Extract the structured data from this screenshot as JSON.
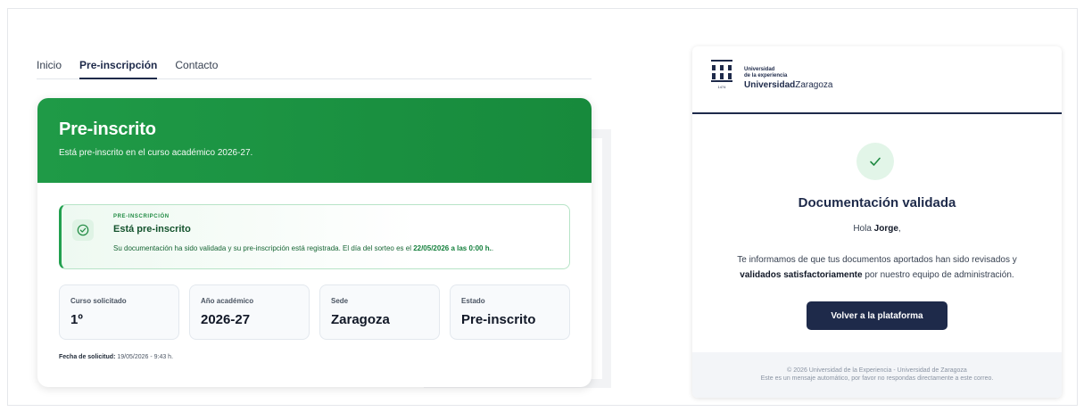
{
  "tabs": [
    {
      "label": "Inicio",
      "active": false
    },
    {
      "label": "Pre-inscripción",
      "active": true
    },
    {
      "label": "Contacto",
      "active": false
    }
  ],
  "status_card": {
    "title": "Pre-inscrito",
    "subtitle": "Está pre-inscrito en el curso académico 2026-27.",
    "header_color": "#1f9a47",
    "notice": {
      "label": "PRE-INSCRIPCIÓN",
      "title": "Está pre-inscrito",
      "text_before": "Su documentación ha sido validada y su pre-inscripción está registrada. El día del sorteo es el ",
      "text_bold": "22/05/2026 a las 0:00 h.",
      "text_after": "."
    },
    "stats": [
      {
        "label": "Curso solicitado",
        "value": "1º"
      },
      {
        "label": "Año académico",
        "value": "2026-27"
      },
      {
        "label": "Sede",
        "value": "Zaragoza"
      },
      {
        "label": "Estado",
        "value": "Pre-inscrito"
      }
    ],
    "date_label": "Fecha de solicitud:",
    "date_value": "19/05/2026 - 9:43 h."
  },
  "email": {
    "logo": {
      "line1": "Universidad",
      "line2": "de la experiencia",
      "line3_bold": "Universidad",
      "line3_rest": "Zaragoza",
      "year": "1474"
    },
    "title": "Documentación validada",
    "greeting_prefix": "Hola ",
    "greeting_name": "Jorge",
    "greeting_suffix": ",",
    "body_before": "Te informamos de que tus documentos aportados han sido revisados y",
    "body_bold": "validados satisfactoriamente",
    "body_after": " por nuestro equipo de administración.",
    "button_label": "Volver a la plataforma",
    "footer_line1": "© 2026 Universidad de la Experiencia - Universidad de Zaragoza",
    "footer_line2": "Este es un mensaje automático, por favor no respondas directamente a este correo.",
    "accent_color": "#1e2a4a"
  }
}
